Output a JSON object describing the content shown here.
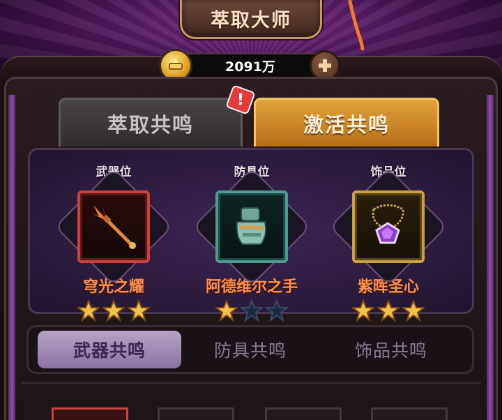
{
  "header": {
    "title": "萃取大师"
  },
  "currency": {
    "amount": "2091万",
    "coin_icon": "gold-coin-icon",
    "add_icon": "plus-icon"
  },
  "tabs": [
    {
      "label": "萃取共鸣",
      "active": false,
      "has_alert": true
    },
    {
      "label": "激活共鸣",
      "active": true
    }
  ],
  "alert_badge": "!",
  "slots": [
    {
      "slot_label": "武器位",
      "item_name": "穹光之耀",
      "item_icon": "trident-icon",
      "frame_color": "#c8433b",
      "stars_filled": 3,
      "stars_total": 3
    },
    {
      "slot_label": "防具位",
      "item_name": "阿德维尔之手",
      "item_icon": "gauntlet-icon",
      "frame_color": "#4d9a92",
      "stars_filled": 1,
      "stars_total": 3
    },
    {
      "slot_label": "饰品位",
      "item_name": "紫晖圣心",
      "item_icon": "amulet-icon",
      "frame_color": "#c8a142",
      "stars_filled": 3,
      "stars_total": 3
    }
  ],
  "sub_tabs": [
    {
      "label": "武器共鸣",
      "active": true
    },
    {
      "label": "防具共鸣",
      "active": false
    },
    {
      "label": "饰品共鸣",
      "active": false
    }
  ],
  "colors": {
    "accent_orange": "#ff8f4a",
    "star_gold": "#f2c14a",
    "star_empty": "#1e2740"
  }
}
